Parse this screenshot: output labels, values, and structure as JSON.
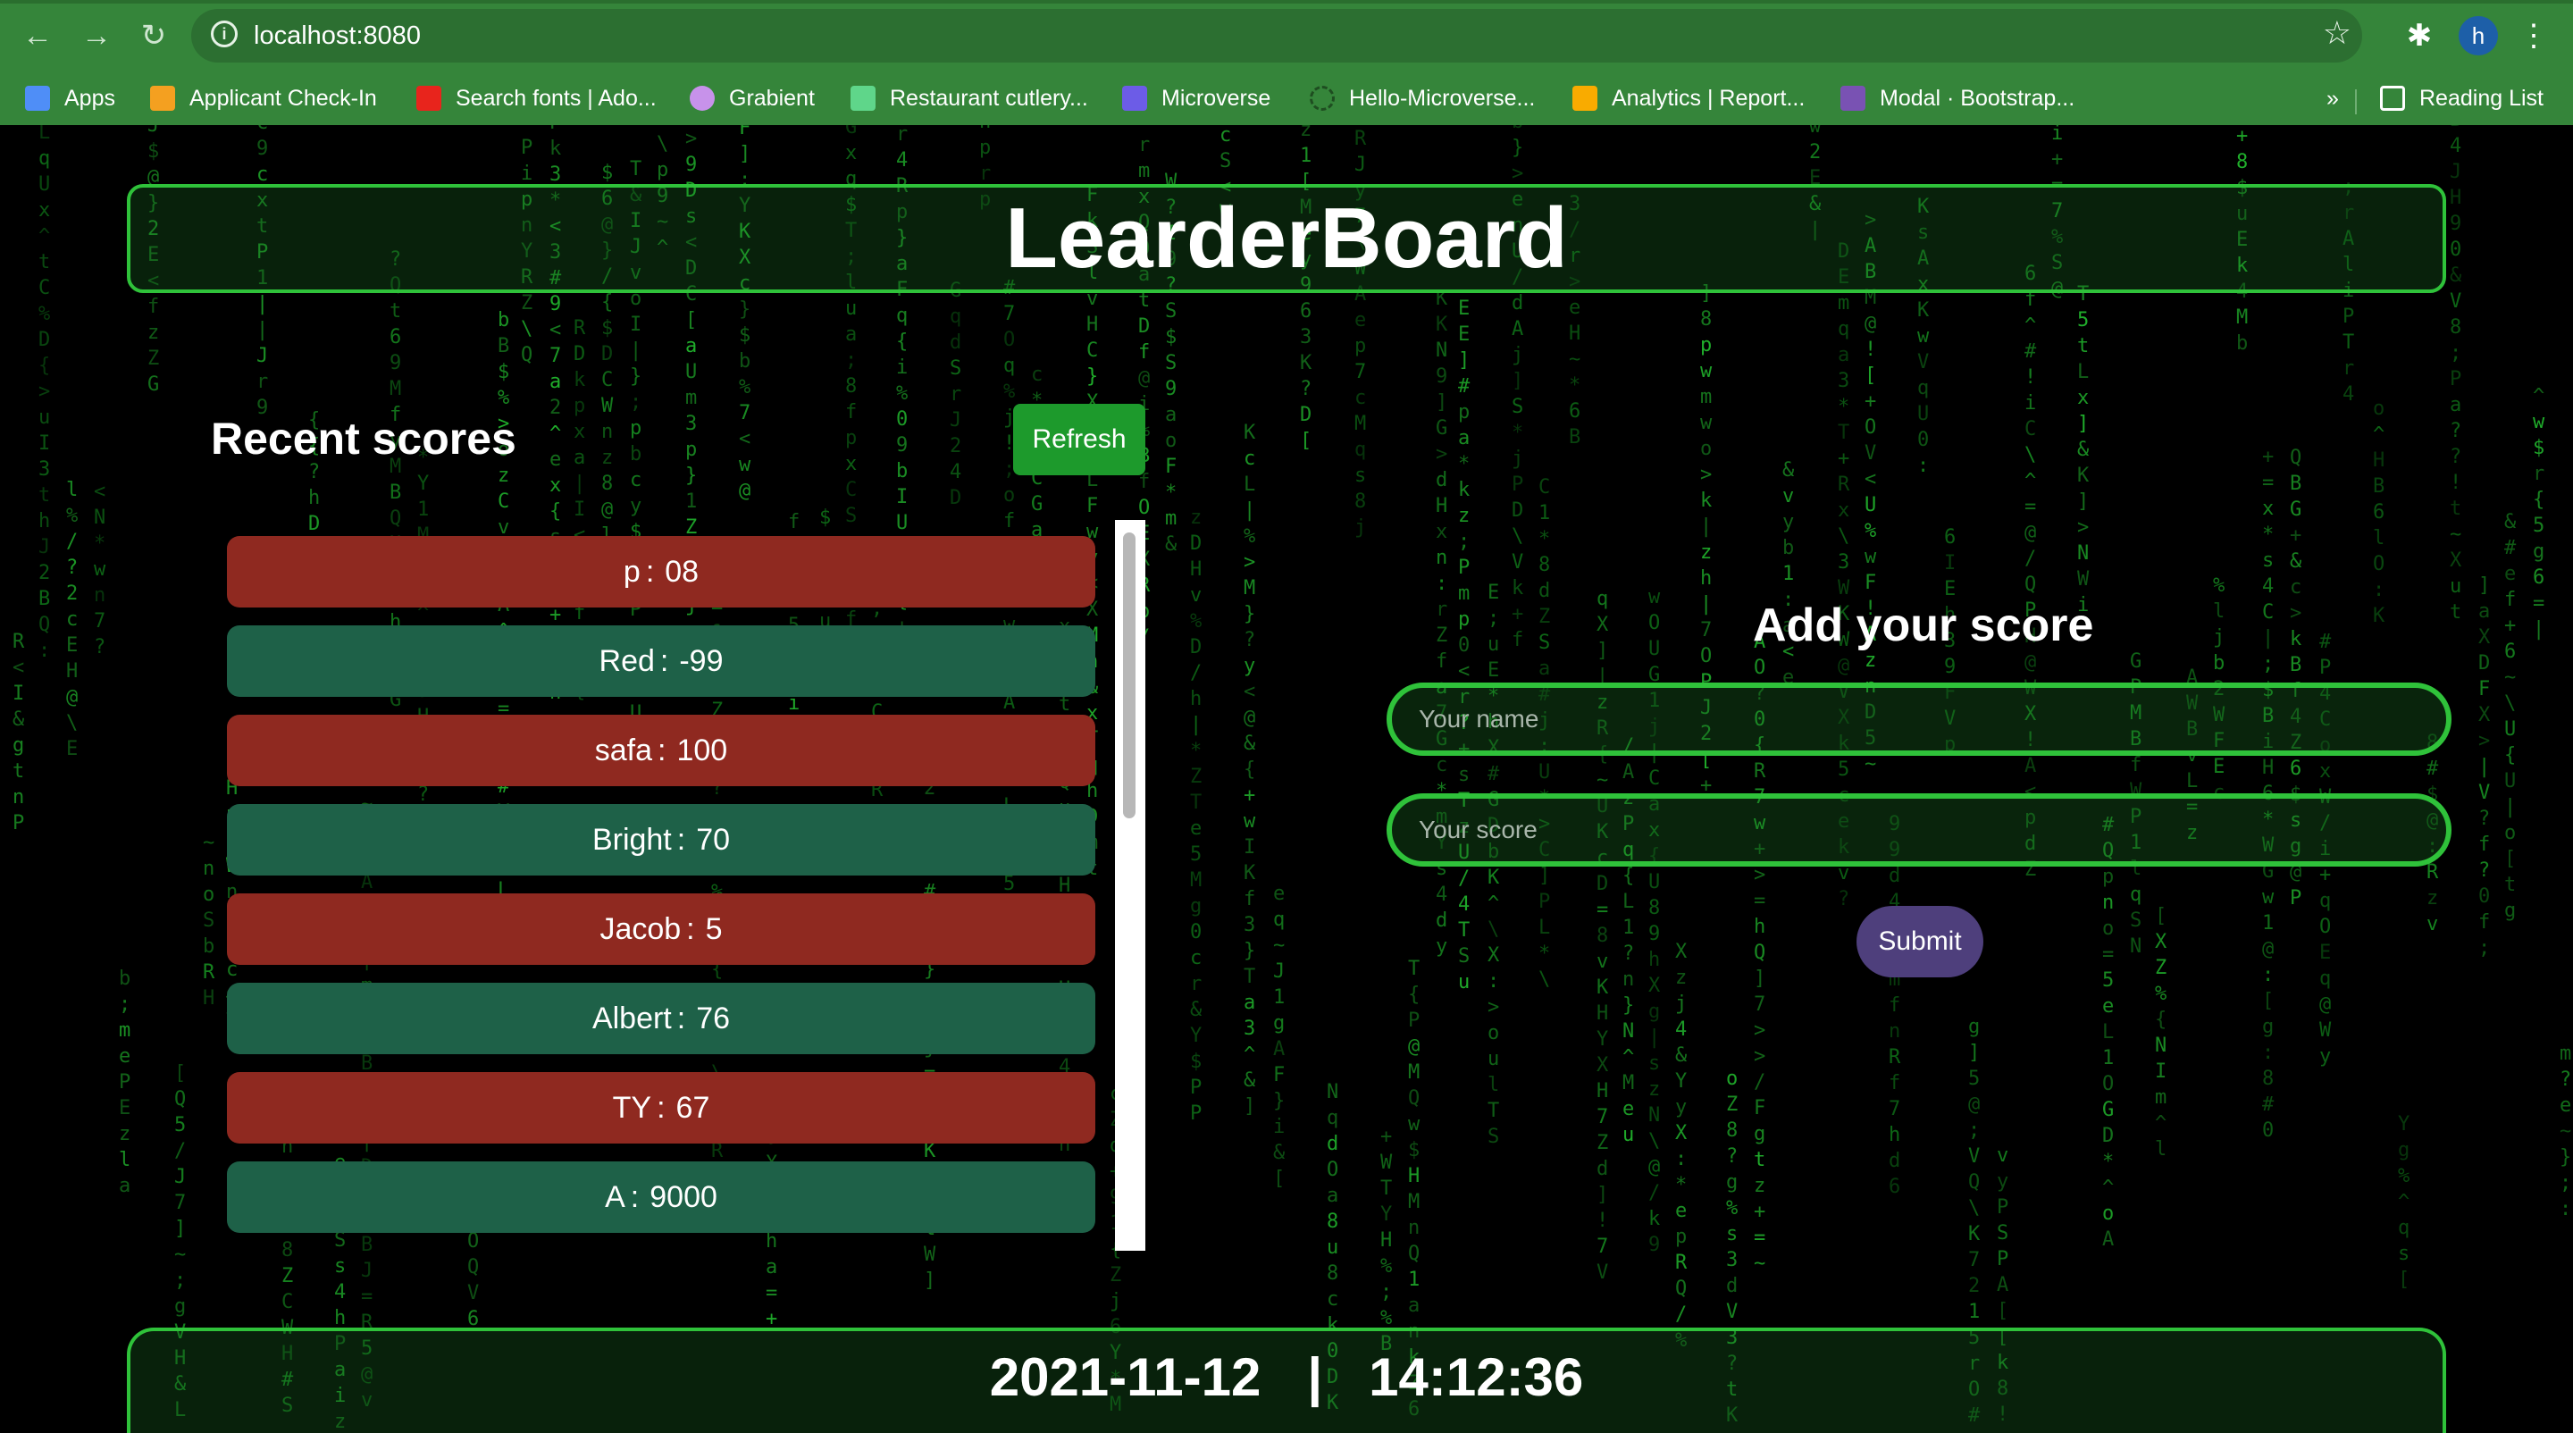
{
  "browser": {
    "url": "localhost:8080",
    "profile_initial": "h",
    "overflow": "»",
    "icons": {
      "back": "arrow-left-icon",
      "forward": "arrow-right-icon",
      "reload": "reload-icon",
      "info": "info-icon",
      "star": "star-icon",
      "extensions": "puzzle-icon",
      "menu": "kebab-menu-icon"
    },
    "bookmarks": [
      {
        "label": "Apps",
        "icon": "apps-grid-icon",
        "color": "#4f8ef7"
      },
      {
        "label": "Applicant Check-In",
        "icon": "cube-icon",
        "color": "#f4a020"
      },
      {
        "label": "Search fonts | Ado...",
        "icon": "adobe-icon",
        "color": "#e8241c"
      },
      {
        "label": "Grabient",
        "icon": "gradient-circle-icon",
        "color": "#c792ea"
      },
      {
        "label": "Restaurant cutlery...",
        "icon": "vectorstock-icon",
        "color": "#5fd68a"
      },
      {
        "label": "Microverse",
        "icon": "microverse-icon",
        "color": "#6c5ce7"
      },
      {
        "label": "Hello-Microverse...",
        "icon": "loading-circle-icon",
        "color": "#1e4d20"
      },
      {
        "label": "Analytics | Report...",
        "icon": "analytics-icon",
        "color": "#f9ab00"
      },
      {
        "label": "Modal · Bootstrap...",
        "icon": "bootstrap-icon",
        "color": "#7952b3"
      }
    ],
    "reading_list": "Reading List"
  },
  "header": {
    "title": "LearderBoard"
  },
  "recent": {
    "title": "Recent scores",
    "refresh_label": "Refresh",
    "scores": [
      {
        "name": "p",
        "score": "08",
        "color": "red"
      },
      {
        "name": "Red",
        "score": "-99",
        "color": "green"
      },
      {
        "name": "safa",
        "score": "100",
        "color": "red"
      },
      {
        "name": "Bright",
        "score": "70",
        "color": "green"
      },
      {
        "name": "Jacob",
        "score": "5",
        "color": "red"
      },
      {
        "name": "Albert",
        "score": "76",
        "color": "green"
      },
      {
        "name": "TY",
        "score": "67",
        "color": "red"
      },
      {
        "name": "A",
        "score": "9000",
        "color": "green"
      }
    ]
  },
  "form": {
    "title": "Add your score",
    "name_placeholder": "Your name",
    "score_placeholder": "Your score",
    "submit_label": "Submit"
  },
  "footer": {
    "date": "2021-11-12",
    "separator": "|",
    "time": "14:12:36"
  },
  "colors": {
    "accent_green": "#2fc23a",
    "row_red": "#8f2920",
    "row_green": "#1e6148",
    "refresh": "#1d9a2c",
    "submit": "#4e3f7c",
    "chrome": "#35853a"
  }
}
